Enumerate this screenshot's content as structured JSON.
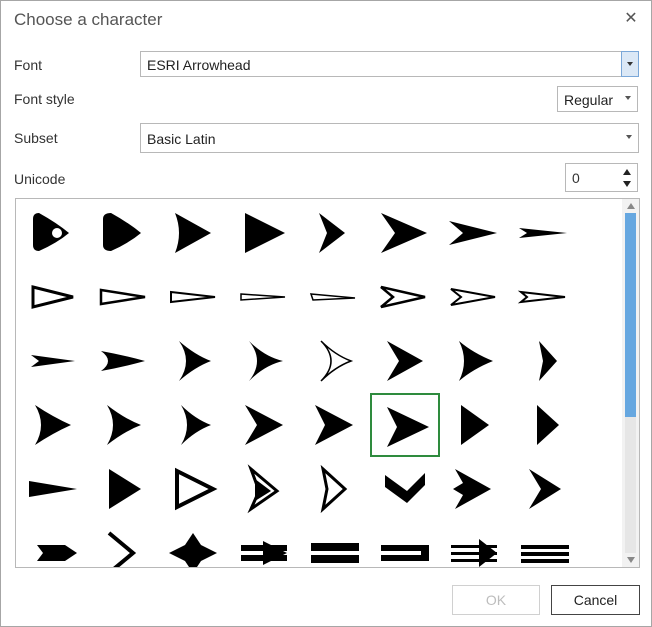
{
  "dialog": {
    "title": "Choose a character"
  },
  "form": {
    "font_label": "Font",
    "font_value": "ESRI Arrowhead",
    "font_style_label": "Font style",
    "font_style_value": "Regular",
    "subset_label": "Subset",
    "subset_value": "Basic Latin",
    "unicode_label": "Unicode",
    "unicode_value": "0"
  },
  "glyph_grid": {
    "selected_index": 29,
    "glyphs": [
      "arrowhead-rounded-hole-icon",
      "arrowhead-rounded-icon",
      "arrowhead-wedge-icon",
      "arrowhead-solid-large-icon",
      "arrowhead-notched-icon",
      "arrowhead-barbed-icon",
      "arrowhead-narrow-barbed-icon",
      "arrowhead-thin-icon",
      "arrowhead-outline-icon",
      "arrowhead-outline-narrow-icon",
      "arrowhead-outline-thin-icon",
      "arrowhead-outline-hairline-icon",
      "arrowhead-outline-hairline-2-icon",
      "arrowhead-outline-barbed-icon",
      "arrowhead-outline-barbed-2-icon",
      "arrowhead-outline-barbed-thin-icon",
      "arrowhead-dart-icon",
      "arrowhead-dart-wide-icon",
      "arrowhead-curved-barb-icon",
      "arrowhead-curved-barb-2-icon",
      "arrowhead-curved-thin-icon",
      "arrowhead-curved-barb-3-icon",
      "arrowhead-curved-barb-4-icon",
      "arrowhead-chevron-curved-icon",
      "arrowhead-notched-2-icon",
      "arrowhead-notched-3-icon",
      "arrowhead-curved-barb-5-icon",
      "arrowhead-notched-4-icon",
      "arrowhead-notched-5-icon",
      "arrowhead-notched-selected-icon",
      "arrowhead-triangle-icon",
      "arrowhead-triangle-narrow-icon",
      "arrowhead-flat-icon",
      "arrowhead-fat-icon",
      "arrowhead-outline-fat-icon",
      "arrowhead-outline-split-icon",
      "arrowhead-double-chevron-icon",
      "arrowhead-boomerang-icon",
      "arrowhead-double-barb-icon",
      "arrowhead-chevron-bold-icon",
      "arrowhead-pentagon-icon",
      "arrowhead-chevron-line-icon",
      "arrowhead-star-icon",
      "arrowhead-striped-icon",
      "arrowhead-striped-2-icon",
      "arrowhead-striped-3-icon",
      "arrowhead-striped-4-icon",
      "arrowhead-striped-5-icon"
    ]
  },
  "scrollbar": {
    "position_fraction": 0.0,
    "visible_fraction": 0.6
  },
  "buttons": {
    "ok_label": "OK",
    "cancel_label": "Cancel"
  },
  "colors": {
    "selection": "#2e8b3e",
    "scroll_thumb": "#66a7e0"
  }
}
